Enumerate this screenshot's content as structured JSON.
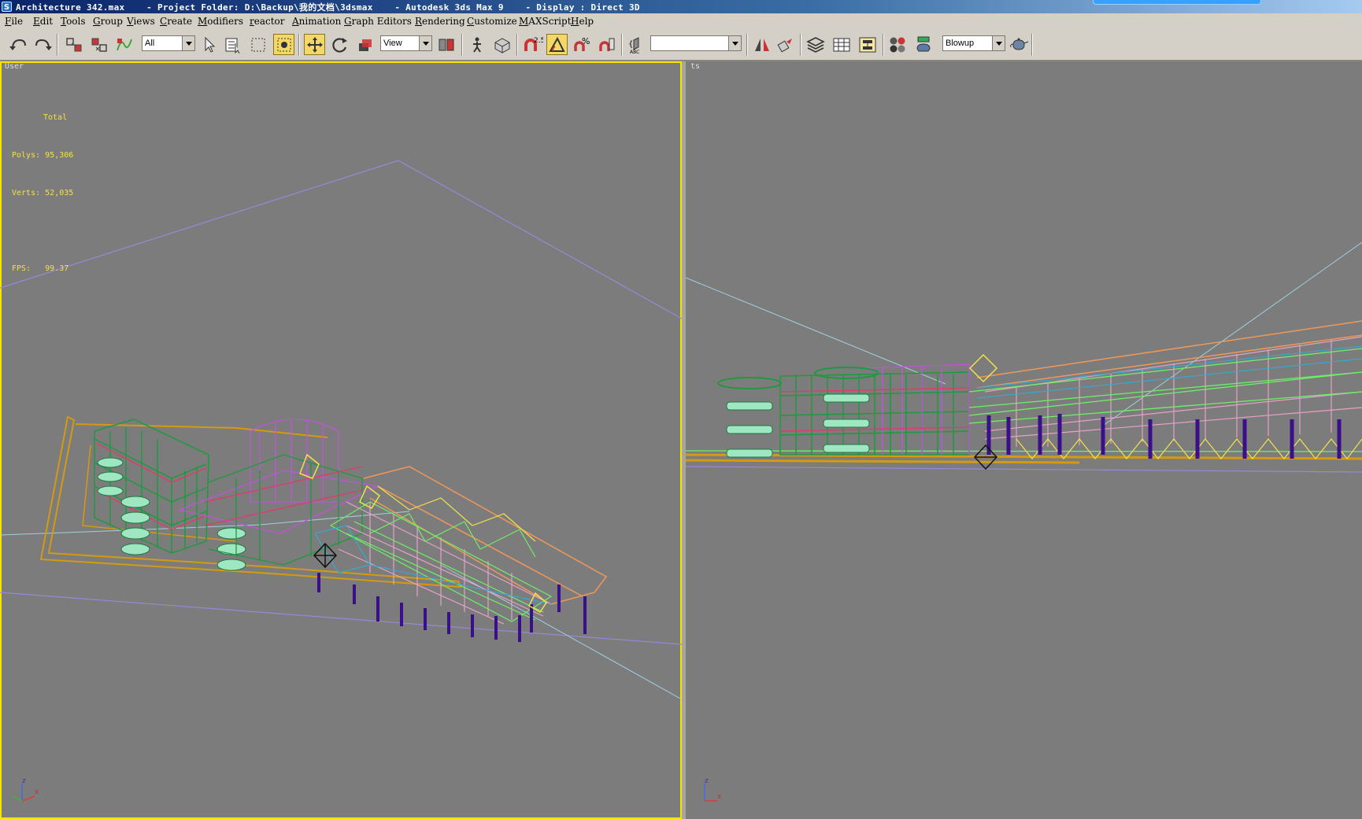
{
  "titlebar": {
    "text": "Architecture 342.max    - Project Folder: D:\\Backup\\我的文档\\3dsmax    - Autodesk 3ds Max 9    - Display : Direct 3D"
  },
  "menu": [
    "File",
    "Edit",
    "Tools",
    "Group",
    "Views",
    "Create",
    "Modifiers",
    "reactor",
    "Animation",
    "Graph Editors",
    "Rendering",
    "Customize",
    "MAXScript",
    "Help"
  ],
  "toolbar": {
    "selection_filter": "All",
    "reference_coord": "View",
    "named_selection": "",
    "render_preset": "Blowup",
    "snap_angle_label": "2.5"
  },
  "viewport_left": {
    "label": "User",
    "stats": {
      "heading": "Total",
      "polys_label": "Polys:",
      "polys": "95,306",
      "verts_label": "Verts:",
      "verts": "52,035",
      "fps_label": "FPS:",
      "fps": "99.37"
    }
  },
  "viewport_right": {
    "label": "ts"
  },
  "axis": {
    "z": "z",
    "x": "x"
  },
  "colors": {
    "viewport_bg": "#7c7c7c",
    "active_border": "#f5e400",
    "stats_text": "#f2e24a",
    "toolbar_bg": "#d4d0c8",
    "title_bg": "#0a246a"
  }
}
